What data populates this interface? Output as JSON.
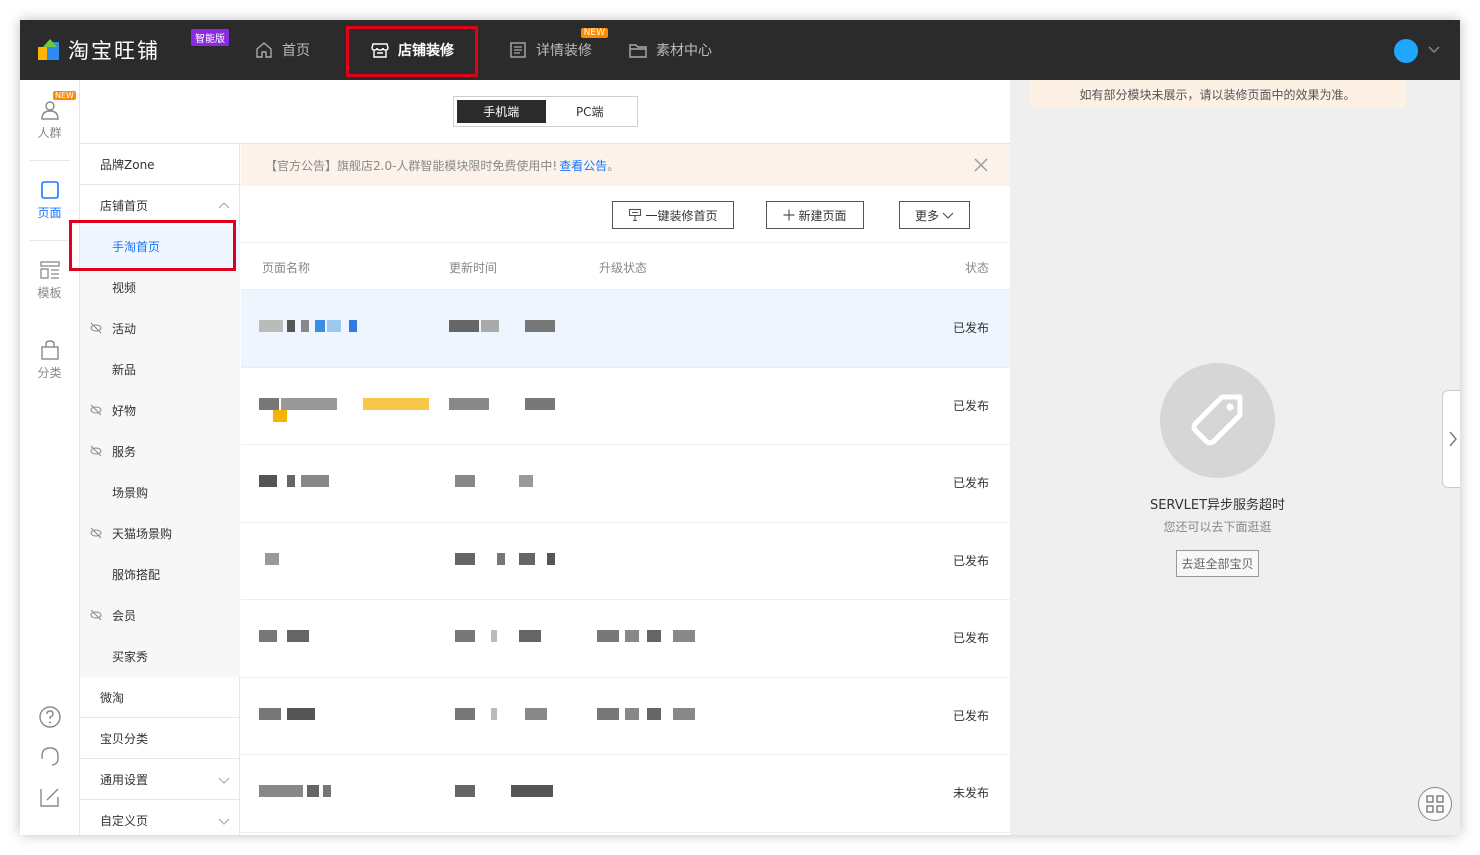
{
  "app": {
    "logo_text": "淘宝旺铺",
    "logo_badge": "智能版"
  },
  "nav": {
    "home": "首页",
    "shop_decor": "店铺装修",
    "detail_decor": "详情装修",
    "detail_badge": "NEW",
    "materials": "素材中心"
  },
  "rail": {
    "crowd": "人群",
    "crowd_badge": "NEW",
    "page": "页面",
    "template": "模板",
    "category": "分类"
  },
  "switch": {
    "mobile": "手机端",
    "pc": "PC端"
  },
  "menu": {
    "brand_zone": "品牌Zone",
    "shop_home": "店铺首页",
    "mobile_home": "手淘首页",
    "video": "视频",
    "activity": "活动",
    "new_items": "新品",
    "good_items": "好物",
    "service": "服务",
    "scene_buy": "场景购",
    "tmall_scene": "天猫场景购",
    "outfit": "服饰搭配",
    "member": "会员",
    "buyer_show": "买家秀",
    "weitao": "微淘",
    "item_category": "宝贝分类",
    "general_settings": "通用设置",
    "custom_page": "自定义页"
  },
  "notice": {
    "text": "【官方公告】旗舰店2.0-人群智能模块限时免费使用中!",
    "link": "查看公告",
    "suffix": "。"
  },
  "toolbar": {
    "one_click": "一键装修首页",
    "new_page": "新建页面",
    "more": "更多"
  },
  "table": {
    "headers": {
      "name": "页面名称",
      "updated": "更新时间",
      "upgrade": "升级状态",
      "status": "状态"
    },
    "rows": [
      {
        "status": "已发布"
      },
      {
        "status": "已发布"
      },
      {
        "status": "已发布"
      },
      {
        "status": "已发布"
      },
      {
        "status": "已发布"
      },
      {
        "status": "已发布"
      },
      {
        "status": "未发布"
      }
    ]
  },
  "preview": {
    "tip": "如有部分模块未展示，请以装修页面中的效果为准。",
    "error_title": "SERVLET异步服务超时",
    "error_sub": "您还可以去下面逛逛",
    "browse_button": "去逛全部宝贝"
  },
  "colors": {
    "topbar": "#2b2b2b",
    "accent": "#1677ff",
    "highlight_box": "#e0001b",
    "notice_bg": "#fdf2ea"
  }
}
